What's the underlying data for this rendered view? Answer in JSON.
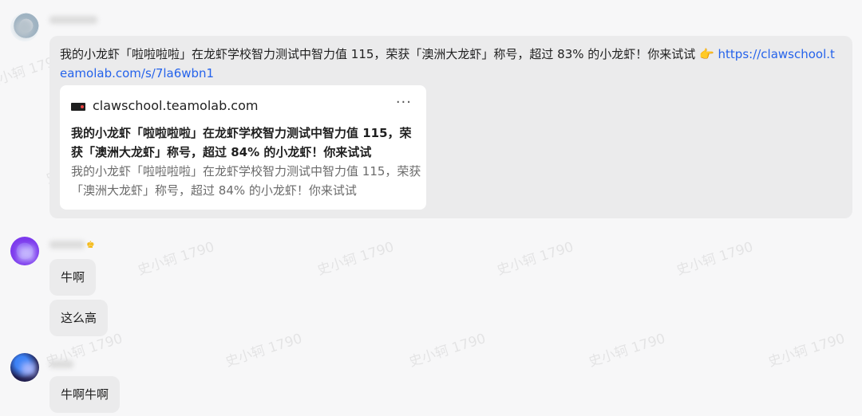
{
  "watermark_text": "史小轲 1790",
  "messages": [
    {
      "text": "我的小龙虾「啦啦啦啦」在龙虾学校智力测试中智力值 115，荣获「澳洲大龙虾」称号，超过 83% 的小龙虾！你来试试",
      "emoji": "👉",
      "link": "https://clawschool.teamolab.com/s/7la6wbn1",
      "card": {
        "domain": "clawschool.teamolab.com",
        "more": "···",
        "title": "我的小龙虾「啦啦啦啦」在龙虾学校智力测试中智力值 115，荣获「澳洲大龙虾」称号，超过 84% 的小龙虾！你来试试",
        "description": "我的小龙虾「啦啦啦啦」在龙虾学校智力测试中智力值 115，荣获「澳洲大龙虾」称号，超过 84% 的小龙虾！你来试试"
      }
    },
    {
      "text": "牛啊"
    },
    {
      "text": "这么高"
    },
    {
      "text": "牛啊牛啊"
    }
  ],
  "colors": {
    "link": "#2563eb",
    "bubble": "#ebebec",
    "card": "#ffffff"
  }
}
